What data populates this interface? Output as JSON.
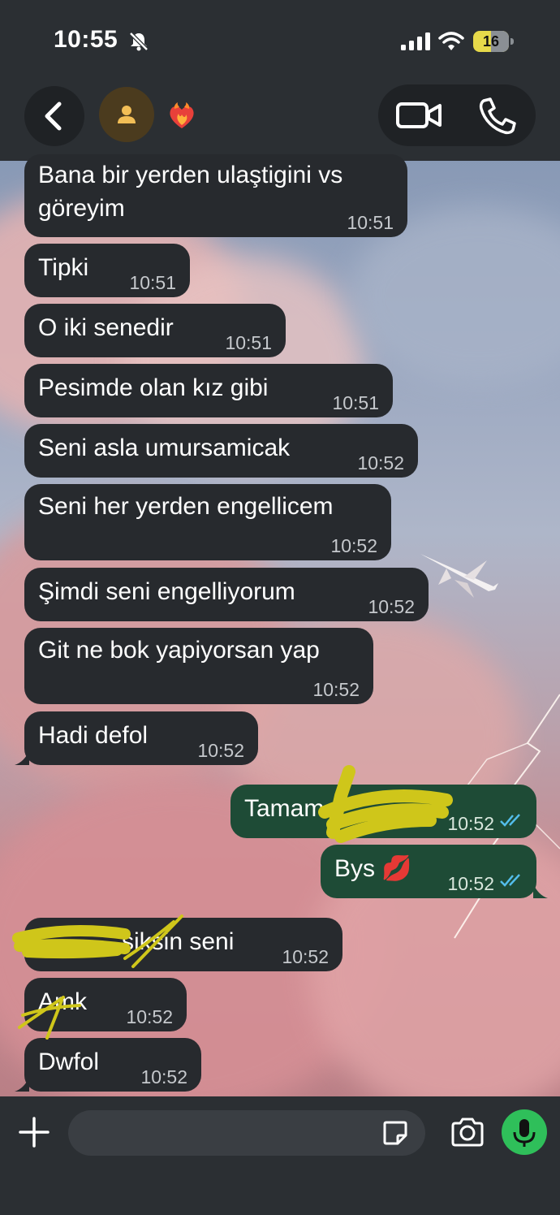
{
  "status_bar": {
    "time": "10:55",
    "battery_level": "16",
    "battery_fraction": 0.16
  },
  "header": {
    "contact_emoji": "❤️‍🔥",
    "icons": [
      "back-icon",
      "avatar-icon",
      "video-call-icon",
      "voice-call-icon"
    ]
  },
  "colors": {
    "header_bg": "#2b2f33",
    "incoming_bubble": "#272a2e",
    "outgoing_bubble": "#1e4b36",
    "read_ticks": "#53bdeb",
    "mic_button": "#2fbf5a",
    "battery": "#e6d94a"
  },
  "messages": [
    {
      "direction": "in",
      "text": "Bana bir yerden ulaştigini vs göreyim",
      "line1": "Bana bir yerden ulaştigini vs",
      "line2": "göreyim",
      "time": "10:51"
    },
    {
      "direction": "in",
      "text": "Tipki",
      "time": "10:51"
    },
    {
      "direction": "in",
      "text": "O iki senedir",
      "time": "10:51"
    },
    {
      "direction": "in",
      "text": "Pesimde olan kız gibi",
      "time": "10:51"
    },
    {
      "direction": "in",
      "text": "Seni asla umursamicak",
      "time": "10:52"
    },
    {
      "direction": "in",
      "text": "Seni her yerden engellicem",
      "time": "10:52"
    },
    {
      "direction": "in",
      "text": "Şimdi seni engelliyorum",
      "time": "10:52"
    },
    {
      "direction": "in",
      "text": "Git ne bok yapiyorsan yap",
      "time": "10:52"
    },
    {
      "direction": "in",
      "text": "Hadi defol",
      "time": "10:52"
    },
    {
      "direction": "out",
      "text": "Tamam",
      "time": "10:52",
      "status": "read"
    },
    {
      "direction": "out",
      "text": "Bys 💋",
      "time": "10:52",
      "status": "read"
    },
    {
      "direction": "in",
      "text": "siksin seni",
      "time": "10:52"
    },
    {
      "direction": "in",
      "text": "Amk",
      "time": "10:52"
    },
    {
      "direction": "in",
      "text": "Dwfol",
      "time": "10:52"
    }
  ],
  "composer": {
    "placeholder": "",
    "icons": [
      "plus-icon",
      "sticker-icon",
      "camera-icon",
      "microphone-icon"
    ]
  }
}
